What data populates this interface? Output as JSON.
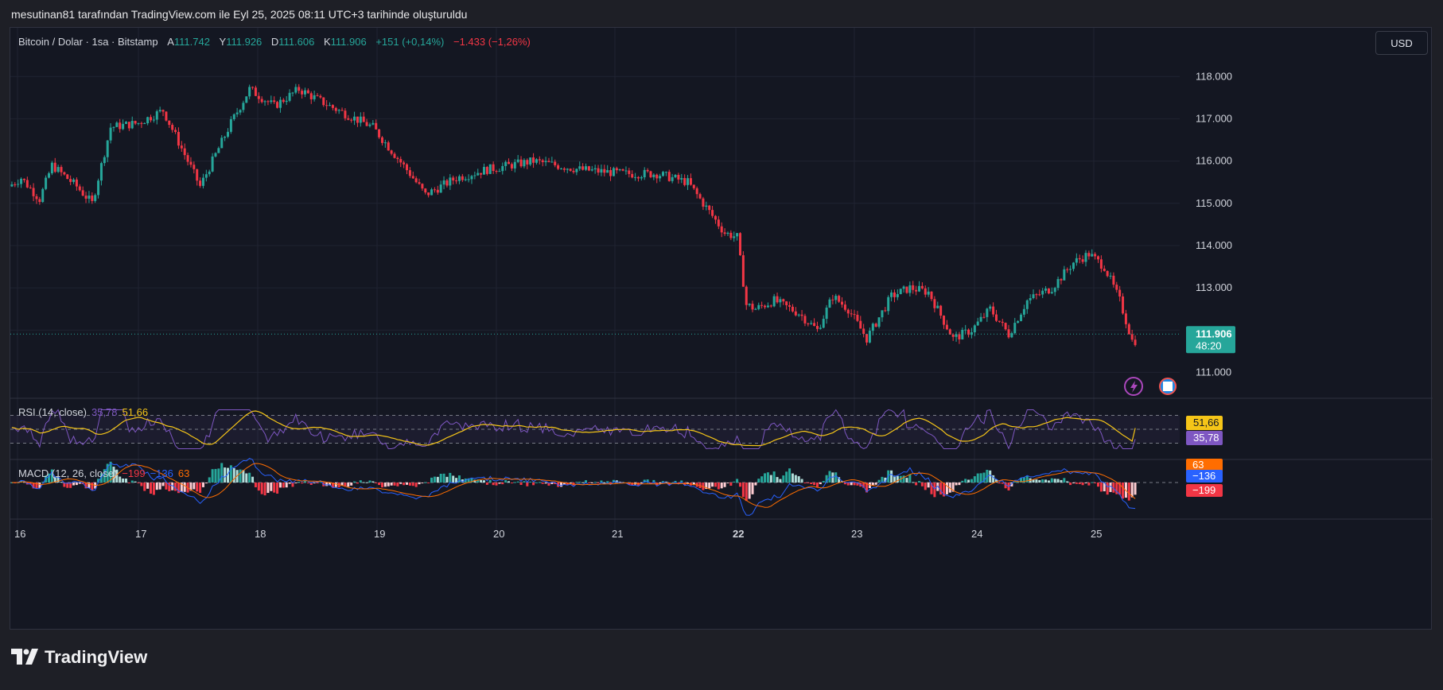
{
  "header": "mesutinan81 tarafından TradingView.com ile Eyl 25, 2025 08:11 UTC+3 tarihinde oluşturuldu",
  "legend": {
    "symbol": "Bitcoin / Dolar · 1sa · Bitstamp",
    "o_key": "A",
    "o_val": "111.742",
    "h_key": "Y",
    "h_val": "111.926",
    "l_key": "D",
    "l_val": "111.606",
    "c_key": "K",
    "c_val": "111.906",
    "change_abs": "+151 (+0,14%)",
    "change_day": "−1.433 (−1,26%)"
  },
  "currency_button": "USD",
  "rsi": {
    "label": "RSI (14, close)",
    "value": "35,78",
    "ma": "51,66"
  },
  "macd": {
    "label": "MACD (12, 26, close)",
    "hist": "−199",
    "macd": "−136",
    "signal": "63"
  },
  "last_price": {
    "value": "111.906",
    "countdown": "48:20"
  },
  "logo": "TradingView",
  "colors": {
    "bg": "#141722",
    "up": "#26a69a",
    "down": "#f23645",
    "rsi": "#7e57c2",
    "rsi_ma": "#f5c518",
    "macd": "#2962ff",
    "signal": "#ff6d00"
  },
  "chart_data": {
    "type": "candlestick",
    "y_ticks": [
      "118.000",
      "117.000",
      "116.000",
      "115.000",
      "114.000",
      "113.000",
      "111.000"
    ],
    "ylim": [
      110500,
      118400
    ],
    "x_ticks": [
      "16",
      "17",
      "18",
      "19",
      "20",
      "21",
      "22",
      "23",
      "24",
      "25"
    ],
    "keyframes": [
      [
        0,
        115400
      ],
      [
        4,
        115600
      ],
      [
        10,
        115100
      ],
      [
        14,
        115900
      ],
      [
        22,
        115400
      ],
      [
        27,
        115000
      ],
      [
        33,
        116800
      ],
      [
        42,
        116900
      ],
      [
        50,
        117200
      ],
      [
        62,
        115400
      ],
      [
        72,
        116900
      ],
      [
        78,
        117700
      ],
      [
        86,
        117300
      ],
      [
        94,
        117700
      ],
      [
        104,
        117300
      ],
      [
        118,
        116800
      ],
      [
        130,
        115700
      ],
      [
        135,
        115200
      ],
      [
        145,
        115600
      ],
      [
        155,
        115800
      ],
      [
        170,
        116000
      ],
      [
        185,
        115800
      ],
      [
        200,
        115700
      ],
      [
        210,
        115700
      ],
      [
        220,
        115500
      ],
      [
        225,
        115000
      ],
      [
        232,
        114300
      ],
      [
        236,
        114200
      ],
      [
        239,
        112600
      ],
      [
        242,
        112500
      ],
      [
        248,
        112700
      ],
      [
        256,
        112400
      ],
      [
        262,
        112000
      ],
      [
        267,
        112800
      ],
      [
        272,
        112500
      ],
      [
        278,
        111800
      ],
      [
        286,
        112800
      ],
      [
        292,
        113000
      ],
      [
        298,
        112900
      ],
      [
        306,
        111800
      ],
      [
        312,
        112000
      ],
      [
        318,
        112500
      ],
      [
        324,
        111900
      ],
      [
        330,
        112700
      ],
      [
        338,
        113000
      ],
      [
        345,
        113600
      ],
      [
        350,
        113800
      ],
      [
        355,
        113500
      ],
      [
        360,
        112700
      ],
      [
        364,
        111750
      ]
    ],
    "rsi": {
      "value": 35.78,
      "ma": 51.66,
      "bands": [
        70,
        50,
        30
      ],
      "ylim": [
        10,
        90
      ]
    },
    "macd": {
      "macd": -136,
      "signal": 63,
      "hist": -199
    }
  }
}
